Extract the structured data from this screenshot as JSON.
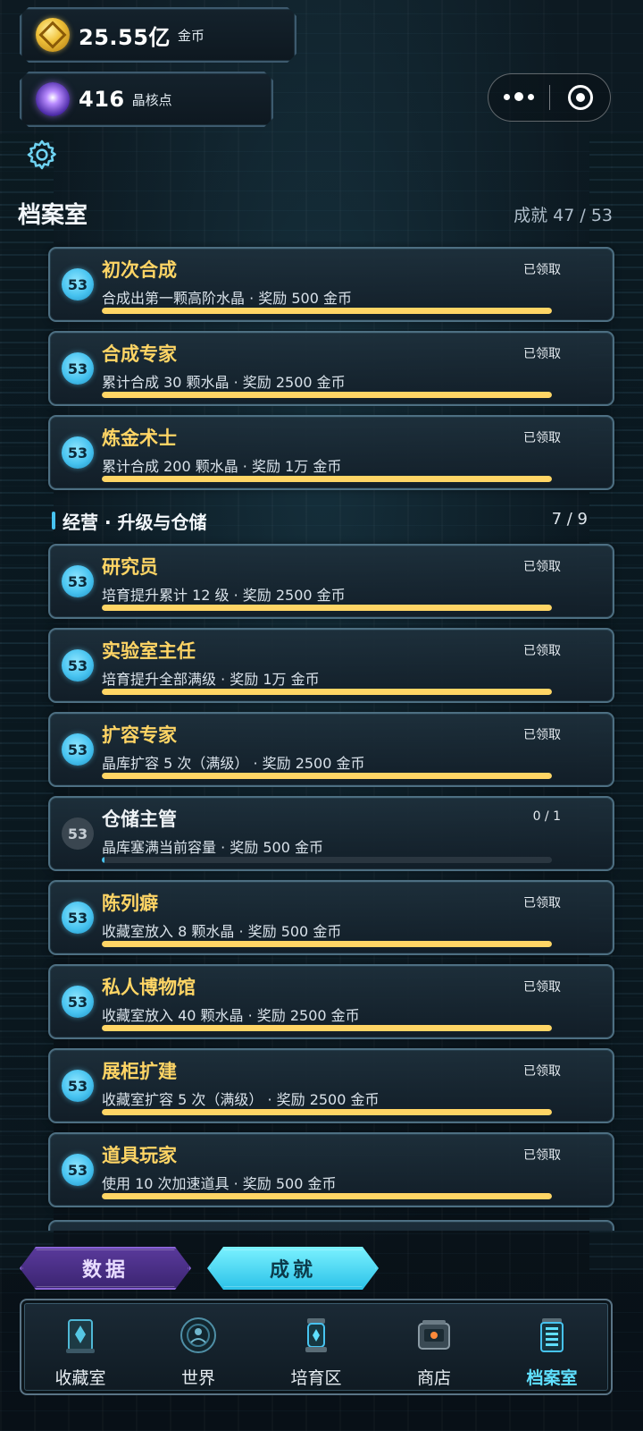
{
  "resources": {
    "gold": {
      "value": "25.55亿",
      "unit": "金币",
      "icon": "gold-coin-icon"
    },
    "core": {
      "value": "416",
      "unit": "晶核点",
      "icon": "crystal-core-icon"
    }
  },
  "header": {
    "title": "档案室",
    "progress_label": "成就 47 / 53"
  },
  "colors": {
    "gold": "#ffd565",
    "cyan": "#47c3f0",
    "panel_border": "#4d6f82"
  },
  "achievements_top": [
    {
      "badge": "53",
      "name": "初次合成",
      "desc": "合成出第一颗高阶水晶 · 奖励 500 金币",
      "status": "已领取",
      "progress": 1.0
    },
    {
      "badge": "53",
      "name": "合成专家",
      "desc": "累计合成 30 颗水晶 · 奖励 2500 金币",
      "status": "已领取",
      "progress": 1.0
    },
    {
      "badge": "53",
      "name": "炼金术士",
      "desc": "累计合成 200 颗水晶 · 奖励 1万 金币",
      "status": "已领取",
      "progress": 1.0
    }
  ],
  "section": {
    "label": "经营 · 升级与仓储",
    "count": "7 / 9"
  },
  "achievements_bottom": [
    {
      "badge": "53",
      "name": "研究员",
      "desc": "培育提升累计 12 级 · 奖励 2500 金币",
      "status": "已领取",
      "progress": 1.0
    },
    {
      "badge": "53",
      "name": "实验室主任",
      "desc": "培育提升全部满级 · 奖励 1万 金币",
      "status": "已领取",
      "progress": 1.0
    },
    {
      "badge": "53",
      "name": "扩容专家",
      "desc": "晶库扩容 5 次（满级） · 奖励 2500 金币",
      "status": "已领取",
      "progress": 1.0
    },
    {
      "badge": "53",
      "name": "仓储主管",
      "desc": "晶库塞满当前容量 · 奖励 500 金币",
      "status": "0 / 1",
      "progress": 0.0,
      "locked": true
    },
    {
      "badge": "53",
      "name": "陈列癖",
      "desc": "收藏室放入 8 颗水晶 · 奖励 500 金币",
      "status": "已领取",
      "progress": 1.0
    },
    {
      "badge": "53",
      "name": "私人博物馆",
      "desc": "收藏室放入 40 颗水晶 · 奖励 2500 金币",
      "status": "已领取",
      "progress": 1.0
    },
    {
      "badge": "53",
      "name": "展柜扩建",
      "desc": "收藏室扩容 5 次（满级） · 奖励 2500 金币",
      "status": "已领取",
      "progress": 1.0
    },
    {
      "badge": "53",
      "name": "道具玩家",
      "desc": "使用 10 次加速道具 · 奖励 500 金币",
      "status": "已领取",
      "progress": 1.0
    }
  ],
  "segments": {
    "data_label": "数据",
    "achievements_label": "成就",
    "selected": "成就"
  },
  "nav": [
    {
      "label": "收藏室",
      "icon": "collection-room-icon"
    },
    {
      "label": "世界",
      "icon": "world-icon"
    },
    {
      "label": "培育区",
      "icon": "incubator-icon"
    },
    {
      "label": "商店",
      "icon": "shop-icon"
    },
    {
      "label": "档案室",
      "icon": "archive-icon",
      "active": true
    }
  ]
}
